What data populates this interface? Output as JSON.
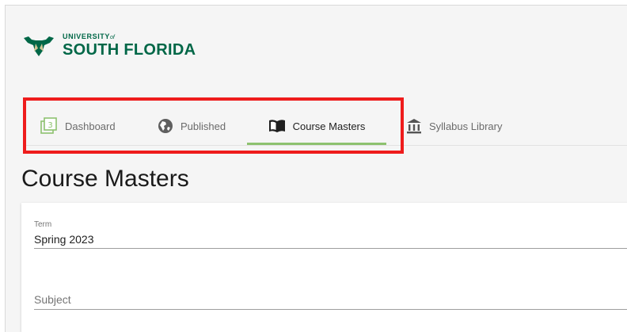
{
  "brand": {
    "line1_main": "UNIVERSITY",
    "line1_of": "of",
    "line2": "SOUTH FLORIDA",
    "color": "#006747",
    "logo_icon": "bull-horns-icon"
  },
  "nav": {
    "tabs": [
      {
        "label": "Dashboard",
        "icon": "dashboard-icon",
        "active": false
      },
      {
        "label": "Published",
        "icon": "globe-icon",
        "active": false
      },
      {
        "label": "Course Masters",
        "icon": "open-book-icon",
        "active": true
      },
      {
        "label": "Syllabus Library",
        "icon": "library-icon",
        "active": false
      }
    ],
    "active_color": "#8dc26f",
    "highlight_color": "#ee1c1c"
  },
  "page": {
    "title": "Course Masters"
  },
  "form": {
    "term": {
      "label": "Term",
      "value": "Spring 2023"
    },
    "subject": {
      "label": "Subject",
      "value": ""
    }
  }
}
